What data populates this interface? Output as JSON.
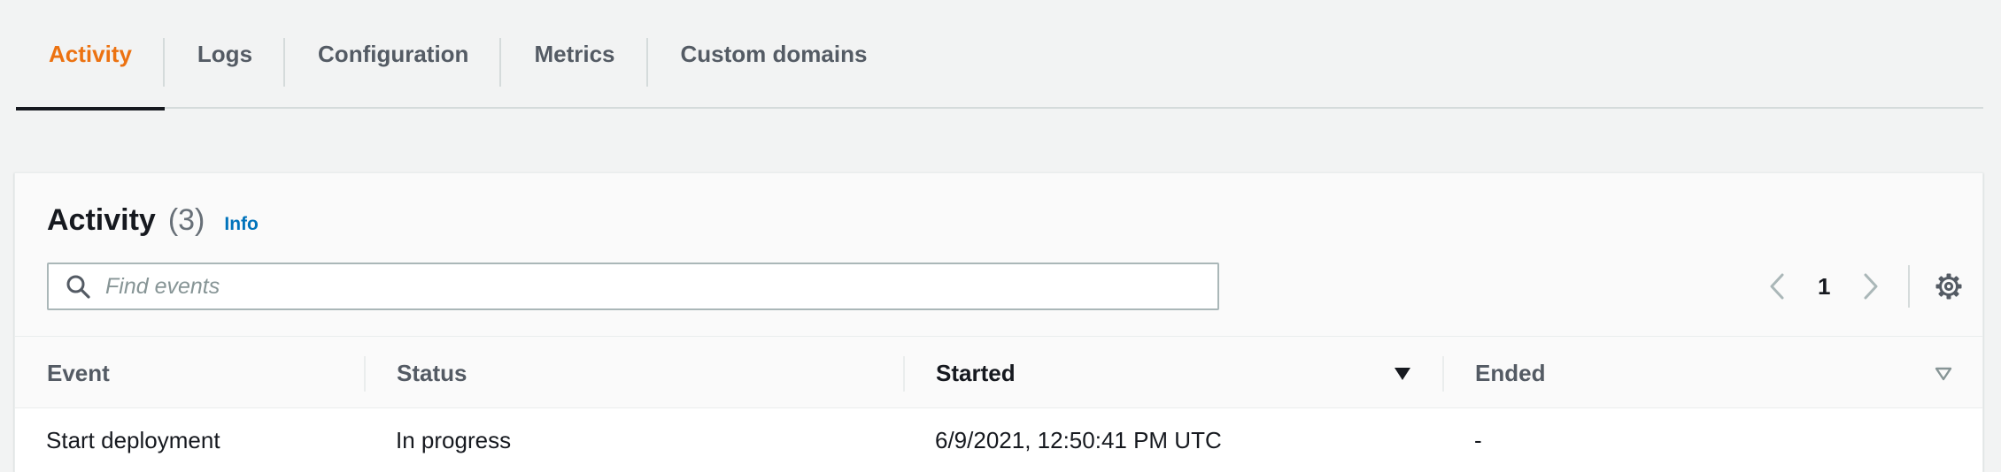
{
  "tabs": [
    {
      "label": "Activity",
      "active": true
    },
    {
      "label": "Logs",
      "active": false
    },
    {
      "label": "Configuration",
      "active": false
    },
    {
      "label": "Metrics",
      "active": false
    },
    {
      "label": "Custom domains",
      "active": false
    }
  ],
  "panel": {
    "title": "Activity",
    "count": "(3)",
    "info_label": "Info"
  },
  "search": {
    "placeholder": "Find events",
    "value": ""
  },
  "pagination": {
    "current_page": "1"
  },
  "table": {
    "columns": [
      {
        "label": "Event",
        "sort": "none"
      },
      {
        "label": "Status",
        "sort": "none"
      },
      {
        "label": "Started",
        "sort": "descending"
      },
      {
        "label": "Ended",
        "sort": "sortable"
      }
    ],
    "rows": [
      [
        "Start deployment",
        "In progress",
        "6/9/2021, 12:50:41 PM UTC",
        "-"
      ]
    ]
  },
  "colors": {
    "accent": "#ec7211",
    "link": "#0073bb",
    "background": "#f2f3f3"
  },
  "icons": {
    "search": "search-icon",
    "prev": "chevron-left-icon",
    "next": "chevron-right-icon",
    "settings": "gear-icon",
    "sort_desc": "caret-down-filled-icon",
    "sort_neutral": "caret-down-outline-icon"
  }
}
